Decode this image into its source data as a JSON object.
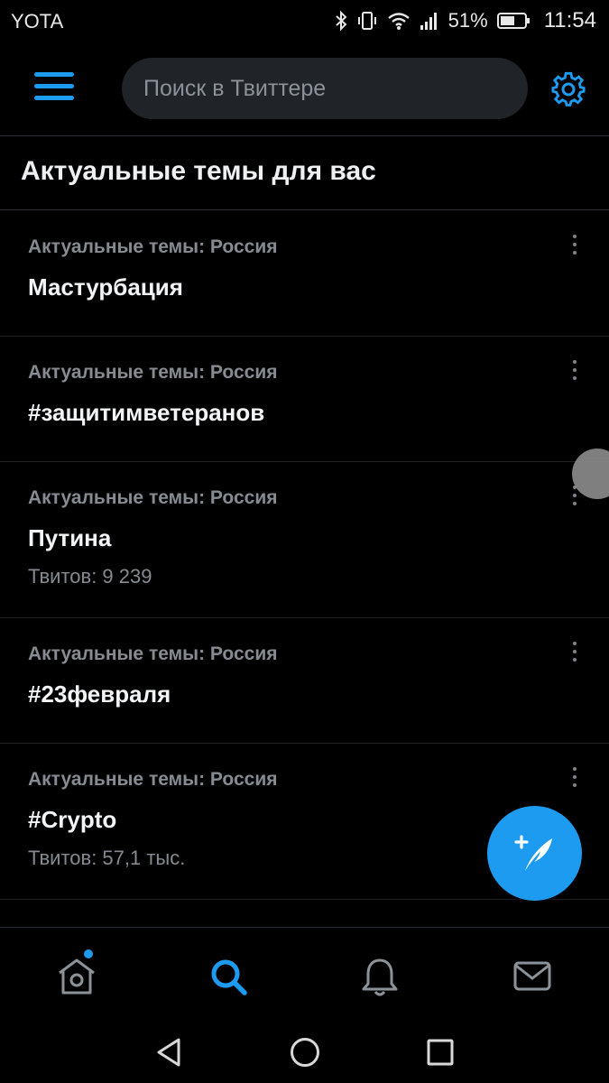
{
  "status_bar": {
    "carrier": "YOTA",
    "battery_percent": "51%",
    "time": "11:54",
    "icons": [
      "bluetooth-icon",
      "vibrate-icon",
      "wifi-icon",
      "signal-icon",
      "battery-icon"
    ]
  },
  "header": {
    "search_placeholder": "Поиск в Твиттере",
    "icons": [
      "menu-icon",
      "gear-icon"
    ],
    "accent_color": "#1d9bf0"
  },
  "section": {
    "title": "Актуальные темы для вас"
  },
  "trends": [
    {
      "context": "Актуальные темы: Россия",
      "name": "Мастурбация",
      "count": ""
    },
    {
      "context": "Актуальные темы: Россия",
      "name": "#защитимветеранов",
      "count": ""
    },
    {
      "context": "Актуальные темы: Россия",
      "name": "Путина",
      "count": "Твитов: 9 239"
    },
    {
      "context": "Актуальные темы: Россия",
      "name": "#23февраля",
      "count": ""
    },
    {
      "context": "Актуальные темы: Россия",
      "name": "#Crypto",
      "count": "Твитов: 57,1 тыс."
    }
  ],
  "fab": {
    "icon": "compose-tweet-icon"
  },
  "bottom_nav": {
    "items": [
      "home-icon",
      "search-icon",
      "notifications-icon",
      "messages-icon"
    ],
    "active": "search-icon",
    "home_has_new": true
  },
  "system_nav": {
    "items": [
      "back-icon",
      "home-circle-icon",
      "recents-icon"
    ]
  }
}
